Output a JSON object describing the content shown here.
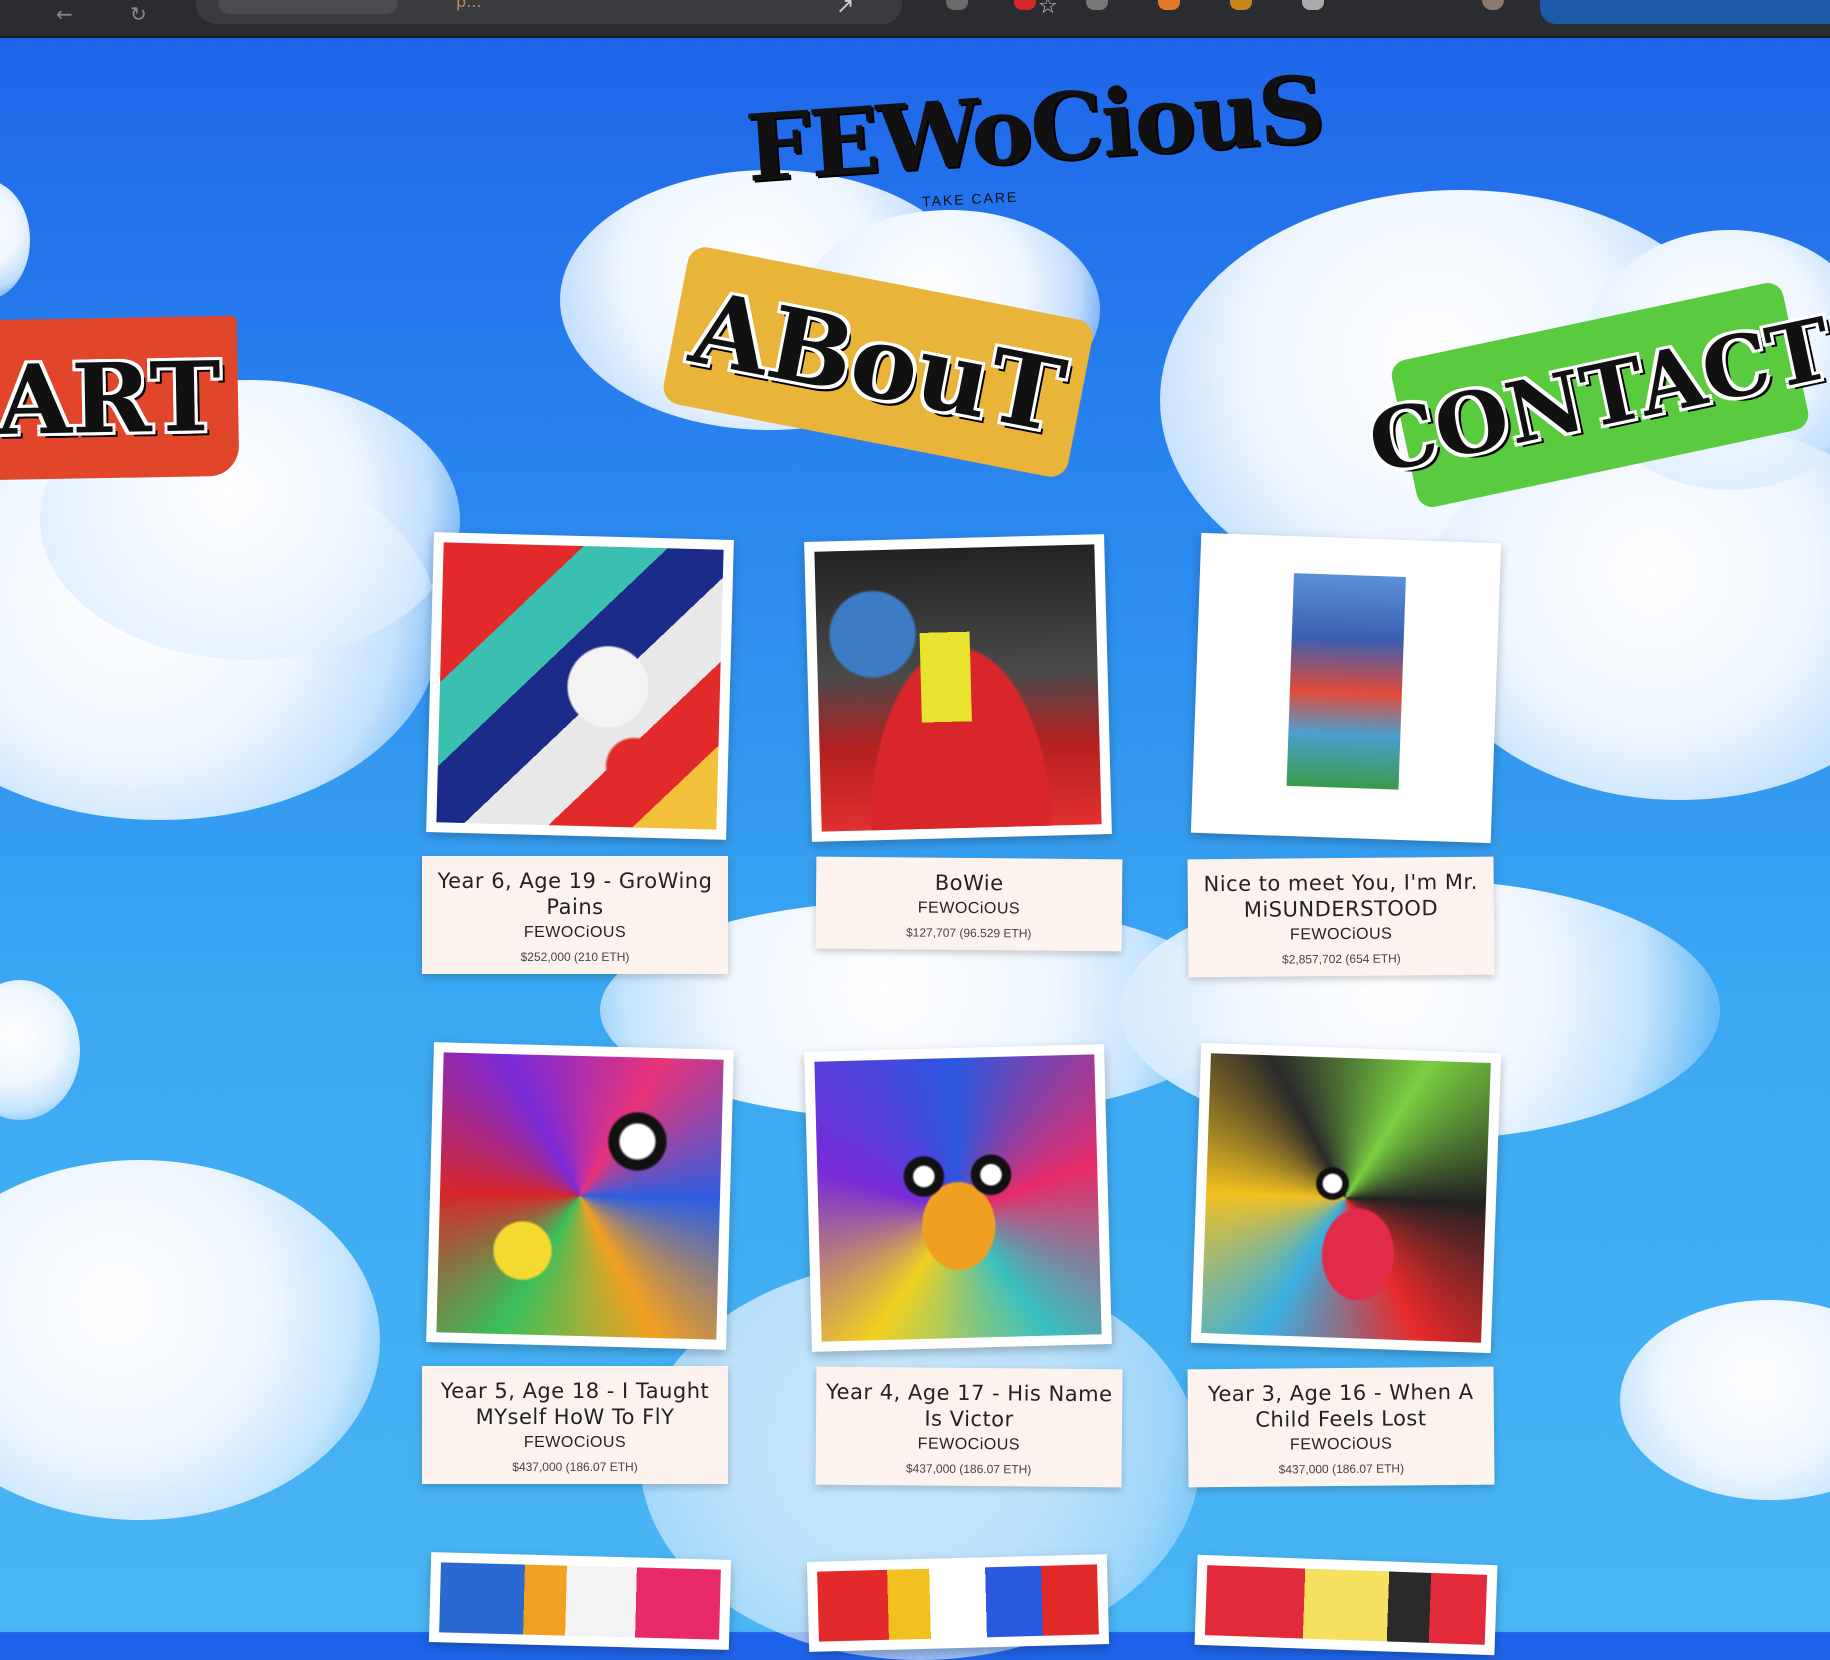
{
  "browser": {
    "back_glyph": "←",
    "reload_glyph": "↻",
    "url_fragment": "p...",
    "star_glyph": "☆"
  },
  "logo": {
    "title": "FEWoCiouS",
    "tagline": "TAKE CARE"
  },
  "nav": {
    "art": "ART",
    "about": "ABouT",
    "contact": "CONTACT"
  },
  "artworks": [
    {
      "title": "Year 6, Age 19 - GroWing Pains",
      "artist": "FEWOCiOUS",
      "price": "$252,000 (210 ETH)"
    },
    {
      "title": "BoWie",
      "artist": "FEWOCiOUS",
      "price": "$127,707 (96.529 ETH)"
    },
    {
      "title": "Nice to meet You, I'm Mr. MiSUNDERSTOOD",
      "artist": "FEWOCiOUS",
      "price": "$2,857,702 (654 ETH)"
    },
    {
      "title": "Year 5, Age 18 - I Taught MYself HoW To FlY",
      "artist": "FEWOCiOUS",
      "price": "$437,000 (186.07 ETH)"
    },
    {
      "title": "Year 4, Age 17 - His Name Is Victor",
      "artist": "FEWOCiOUS",
      "price": "$437,000 (186.07 ETH)"
    },
    {
      "title": "Year 3, Age 16 - When A Child Feels Lost",
      "artist": "FEWOCiOUS",
      "price": "$437,000 (186.07 ETH)"
    }
  ],
  "colors": {
    "sky_top": "#1e63ea",
    "sky_bottom": "#4ab6f4",
    "art_banner": "#e1452a",
    "about_banner": "#e9b43a",
    "contact_banner": "#5acb3e",
    "card_info_bg": "#fcf3ef"
  }
}
